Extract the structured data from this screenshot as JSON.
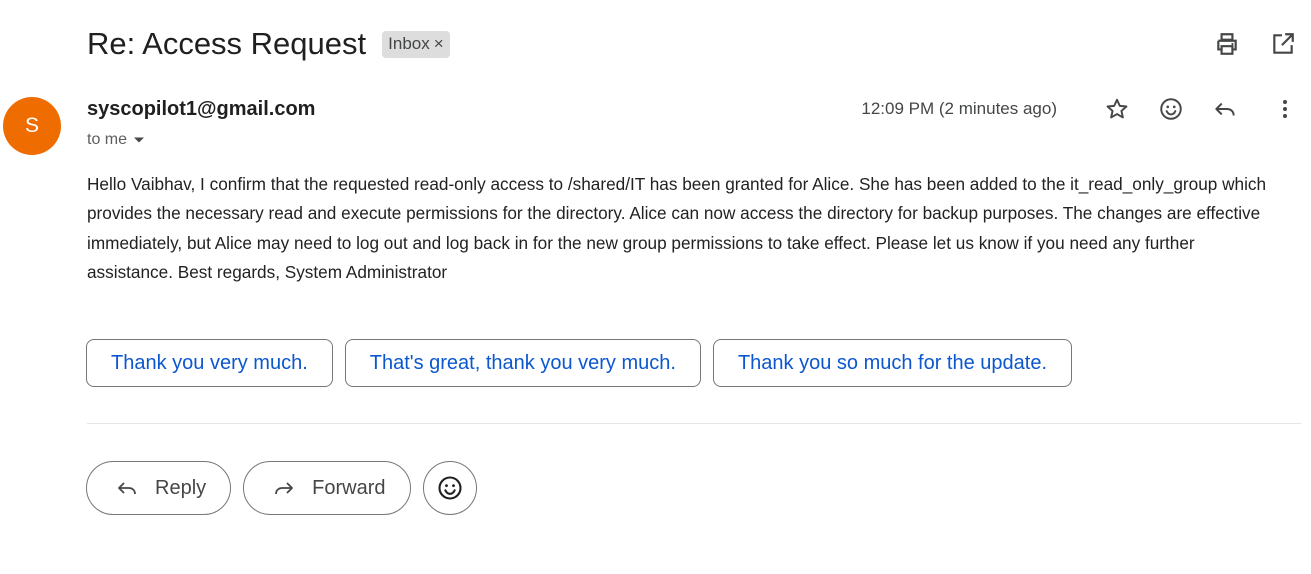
{
  "email": {
    "subject": "Re: Access Request",
    "label": "Inbox",
    "label_remove": "×",
    "sender": "syscopilot1@gmail.com",
    "avatar_letter": "S",
    "recipient": "to me",
    "timestamp": "12:09 PM (2 minutes ago)",
    "body": "Hello Vaibhav, I confirm that the requested read-only access to /shared/IT has been granted for Alice. She has been added to the it_read_only_group which provides the necessary read and execute permissions for the directory. Alice can now access the directory for backup purposes. The changes are effective immediately, but Alice may need to log out and log back in for the new group permissions to take effect. Please let us know if you need any further assistance. Best regards, System Administrator"
  },
  "smart_replies": [
    "Thank you very much.",
    "That's great, thank you very much.",
    "Thank you so much for the update."
  ],
  "actions": {
    "reply_label": "Reply",
    "forward_label": "Forward"
  },
  "icons": {
    "top": [
      "print-icon",
      "open-in-new-window-icon"
    ],
    "meta": [
      "star-icon",
      "emoji-reaction-icon",
      "reply-icon",
      "more-vert-icon"
    ]
  },
  "colors": {
    "avatar": "#ef6c00",
    "link": "#0b57d0",
    "chip_bg": "#dddddd"
  }
}
